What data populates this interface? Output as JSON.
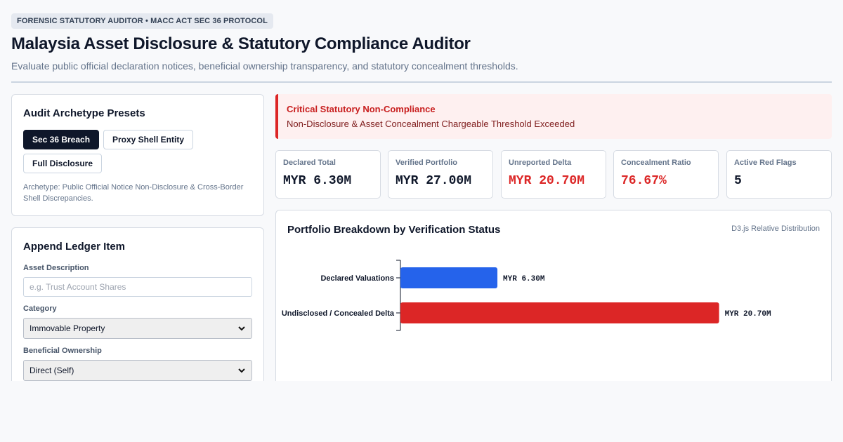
{
  "header": {
    "badge": "FORENSIC STATUTORY AUDITOR • MACC ACT SEC 36 PROTOCOL",
    "title": "Malaysia Asset Disclosure & Statutory Compliance Auditor",
    "subtitle": "Evaluate public official declaration notices, beneficial ownership transparency, and statutory concealment thresholds."
  },
  "presets": {
    "title": "Audit Archetype Presets",
    "buttons": [
      {
        "label": "Sec 36 Breach",
        "active": true
      },
      {
        "label": "Proxy Shell Entity",
        "active": false
      },
      {
        "label": "Full Disclosure",
        "active": false
      }
    ],
    "note": "Archetype: Public Official Notice Non-Disclosure & Cross-Border Shell Discrepancies."
  },
  "ledger": {
    "title": "Append Ledger Item",
    "asset_description_label": "Asset Description",
    "asset_description_placeholder": "e.g. Trust Account Shares",
    "category_label": "Category",
    "category_value": "Immovable Property",
    "ownership_label": "Beneficial Ownership",
    "ownership_value": "Direct (Self)"
  },
  "alert": {
    "title": "Critical Statutory Non-Compliance",
    "text": "Non-Disclosure & Asset Concealment Chargeable Threshold Exceeded"
  },
  "metrics": [
    {
      "label": "Declared Total",
      "value": "MYR 6.30M",
      "alert": false
    },
    {
      "label": "Verified Portfolio",
      "value": "MYR 27.00M",
      "alert": false
    },
    {
      "label": "Unreported Delta",
      "value": "MYR 20.70M",
      "alert": true
    },
    {
      "label": "Concealment Ratio",
      "value": "76.67%",
      "alert": true
    },
    {
      "label": "Active Red Flags",
      "value": "5",
      "alert": false
    }
  ],
  "chart": {
    "title": "Portfolio Breakdown by Verification Status",
    "tag": "D3.js Relative Distribution"
  },
  "colors": {
    "primary_dark": "#0f172a",
    "alert_red": "#dc2626",
    "declared_blue": "#2563eb",
    "concealed_red": "#dc2626"
  },
  "chart_data": {
    "type": "bar",
    "orientation": "horizontal",
    "categories": [
      "Declared Valuations",
      "Undisclosed / Concealed Delta"
    ],
    "values": [
      6.3,
      20.7
    ],
    "value_labels": [
      "MYR 6.30M",
      "MYR 20.70M"
    ],
    "unit": "MYR M",
    "colors": [
      "#2563eb",
      "#dc2626"
    ],
    "xlim": [
      0,
      23
    ]
  }
}
